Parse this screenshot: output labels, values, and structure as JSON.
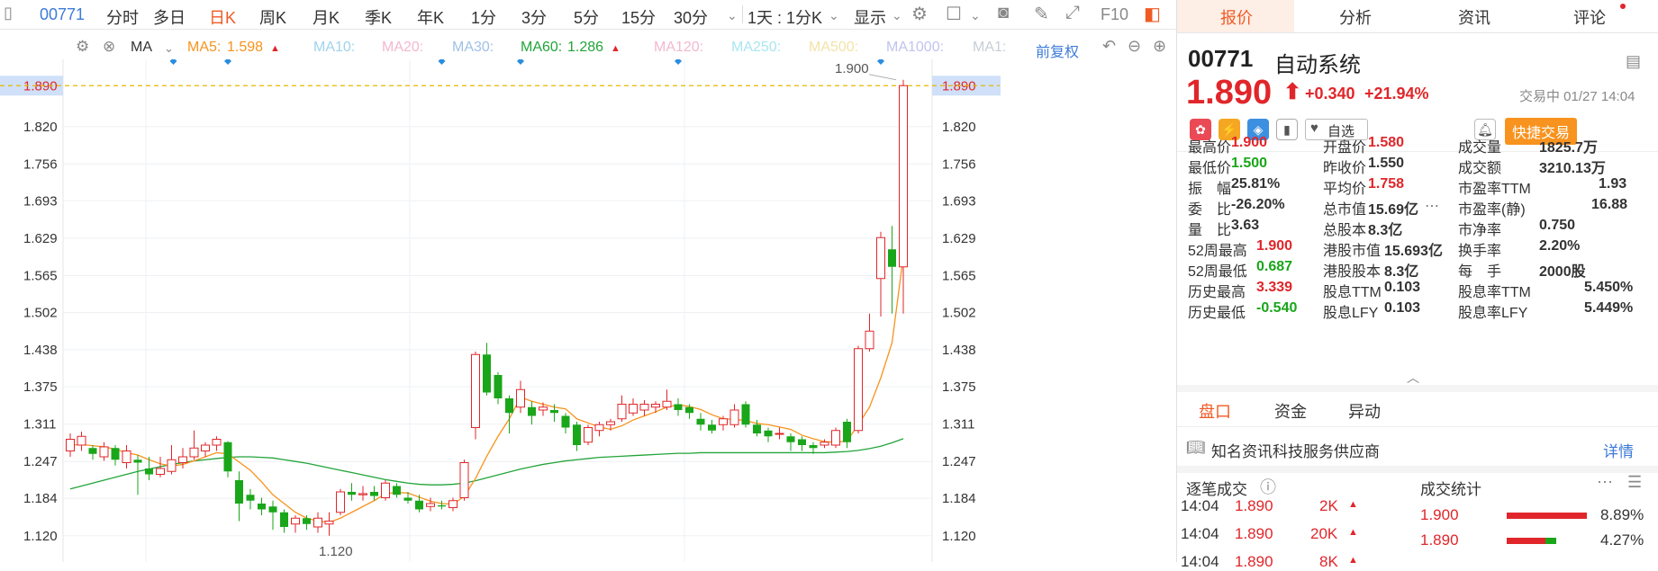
{
  "toolbar": {
    "code": "00771",
    "items": [
      "分时",
      "多日",
      "日K",
      "周K",
      "月K",
      "季K",
      "年K",
      "1分",
      "3分",
      "5分",
      "15分",
      "30分"
    ],
    "active": "日K",
    "combined": "1天 : 1分K",
    "display": "显示",
    "f10": "F10"
  },
  "ma_row": {
    "ma_label": "MA",
    "ma5_label": "MA5:",
    "ma5_value": "1.598",
    "ma10": "MA10:",
    "ma20": "MA20:",
    "ma30": "MA30:",
    "ma60_label": "MA60:",
    "ma60_value": "1.286",
    "ma120": "MA120:",
    "ma250": "MA250:",
    "ma500": "MA500:",
    "ma1000": "MA1000:",
    "ma1": "MA1:",
    "adjust": "前复权"
  },
  "chart_data": {
    "type": "candlestick",
    "price_ticks": [
      "1.890",
      "1.820",
      "1.756",
      "1.693",
      "1.629",
      "1.565",
      "1.502",
      "1.438",
      "1.375",
      "1.311",
      "1.247",
      "1.184",
      "1.120"
    ],
    "current_price_line": 1.89,
    "high_label": "1.900",
    "low_label": "1.120",
    "ylim": [
      1.075,
      1.935
    ],
    "candles": [
      {
        "o": 1.265,
        "c": 1.285,
        "h": 1.295,
        "l": 1.255
      },
      {
        "o": 1.275,
        "c": 1.29,
        "h": 1.298,
        "l": 1.265
      },
      {
        "o": 1.27,
        "c": 1.26,
        "h": 1.275,
        "l": 1.25
      },
      {
        "o": 1.255,
        "c": 1.272,
        "h": 1.28,
        "l": 1.248
      },
      {
        "o": 1.27,
        "c": 1.25,
        "h": 1.275,
        "l": 1.24
      },
      {
        "o": 1.245,
        "c": 1.265,
        "h": 1.275,
        "l": 1.235
      },
      {
        "o": 1.25,
        "c": 1.245,
        "h": 1.258,
        "l": 1.19
      },
      {
        "o": 1.235,
        "c": 1.225,
        "h": 1.255,
        "l": 1.215
      },
      {
        "o": 1.225,
        "c": 1.235,
        "h": 1.255,
        "l": 1.22
      },
      {
        "o": 1.23,
        "c": 1.25,
        "h": 1.275,
        "l": 1.225
      },
      {
        "o": 1.245,
        "c": 1.255,
        "h": 1.27,
        "l": 1.235
      },
      {
        "o": 1.255,
        "c": 1.27,
        "h": 1.3,
        "l": 1.25
      },
      {
        "o": 1.265,
        "c": 1.275,
        "h": 1.28,
        "l": 1.255
      },
      {
        "o": 1.275,
        "c": 1.285,
        "h": 1.29,
        "l": 1.265
      },
      {
        "o": 1.28,
        "c": 1.23,
        "h": 1.282,
        "l": 1.22
      },
      {
        "o": 1.215,
        "c": 1.175,
        "h": 1.23,
        "l": 1.145
      },
      {
        "o": 1.19,
        "c": 1.18,
        "h": 1.2,
        "l": 1.165
      },
      {
        "o": 1.175,
        "c": 1.165,
        "h": 1.185,
        "l": 1.155
      },
      {
        "o": 1.17,
        "c": 1.16,
        "h": 1.18,
        "l": 1.13
      },
      {
        "o": 1.16,
        "c": 1.135,
        "h": 1.165,
        "l": 1.125
      },
      {
        "o": 1.14,
        "c": 1.15,
        "h": 1.155,
        "l": 1.125
      },
      {
        "o": 1.15,
        "c": 1.14,
        "h": 1.155,
        "l": 1.13
      },
      {
        "o": 1.135,
        "c": 1.15,
        "h": 1.16,
        "l": 1.125
      },
      {
        "o": 1.14,
        "c": 1.145,
        "h": 1.16,
        "l": 1.12
      },
      {
        "o": 1.16,
        "c": 1.195,
        "h": 1.2,
        "l": 1.155
      },
      {
        "o": 1.195,
        "c": 1.19,
        "h": 1.21,
        "l": 1.18
      },
      {
        "o": 1.19,
        "c": 1.192,
        "h": 1.205,
        "l": 1.18
      },
      {
        "o": 1.195,
        "c": 1.188,
        "h": 1.205,
        "l": 1.18
      },
      {
        "o": 1.185,
        "c": 1.21,
        "h": 1.215,
        "l": 1.18
      },
      {
        "o": 1.205,
        "c": 1.19,
        "h": 1.21,
        "l": 1.185
      },
      {
        "o": 1.185,
        "c": 1.18,
        "h": 1.195,
        "l": 1.175
      },
      {
        "o": 1.18,
        "c": 1.165,
        "h": 1.19,
        "l": 1.16
      },
      {
        "o": 1.17,
        "c": 1.175,
        "h": 1.185,
        "l": 1.162
      },
      {
        "o": 1.172,
        "c": 1.17,
        "h": 1.18,
        "l": 1.165
      },
      {
        "o": 1.168,
        "c": 1.18,
        "h": 1.185,
        "l": 1.162
      },
      {
        "o": 1.185,
        "c": 1.245,
        "h": 1.25,
        "l": 1.18
      },
      {
        "o": 1.305,
        "c": 1.43,
        "h": 1.435,
        "l": 1.285
      },
      {
        "o": 1.43,
        "c": 1.365,
        "h": 1.45,
        "l": 1.36
      },
      {
        "o": 1.395,
        "c": 1.355,
        "h": 1.4,
        "l": 1.345
      },
      {
        "o": 1.355,
        "c": 1.33,
        "h": 1.36,
        "l": 1.295
      },
      {
        "o": 1.34,
        "c": 1.37,
        "h": 1.385,
        "l": 1.33
      },
      {
        "o": 1.34,
        "c": 1.325,
        "h": 1.35,
        "l": 1.31
      },
      {
        "o": 1.335,
        "c": 1.34,
        "h": 1.348,
        "l": 1.325
      },
      {
        "o": 1.335,
        "c": 1.33,
        "h": 1.345,
        "l": 1.315
      },
      {
        "o": 1.325,
        "c": 1.305,
        "h": 1.33,
        "l": 1.295
      },
      {
        "o": 1.31,
        "c": 1.275,
        "h": 1.315,
        "l": 1.265
      },
      {
        "o": 1.28,
        "c": 1.305,
        "h": 1.31,
        "l": 1.275
      },
      {
        "o": 1.3,
        "c": 1.31,
        "h": 1.315,
        "l": 1.29
      },
      {
        "o": 1.31,
        "c": 1.315,
        "h": 1.32,
        "l": 1.3
      },
      {
        "o": 1.32,
        "c": 1.345,
        "h": 1.36,
        "l": 1.315
      },
      {
        "o": 1.33,
        "c": 1.345,
        "h": 1.355,
        "l": 1.325
      },
      {
        "o": 1.335,
        "c": 1.345,
        "h": 1.352,
        "l": 1.325
      },
      {
        "o": 1.34,
        "c": 1.345,
        "h": 1.35,
        "l": 1.33
      },
      {
        "o": 1.34,
        "c": 1.35,
        "h": 1.37,
        "l": 1.335
      },
      {
        "o": 1.345,
        "c": 1.335,
        "h": 1.355,
        "l": 1.325
      },
      {
        "o": 1.34,
        "c": 1.33,
        "h": 1.345,
        "l": 1.32
      },
      {
        "o": 1.32,
        "c": 1.31,
        "h": 1.33,
        "l": 1.3
      },
      {
        "o": 1.31,
        "c": 1.3,
        "h": 1.318,
        "l": 1.295
      },
      {
        "o": 1.31,
        "c": 1.32,
        "h": 1.325,
        "l": 1.3
      },
      {
        "o": 1.31,
        "c": 1.335,
        "h": 1.345,
        "l": 1.305
      },
      {
        "o": 1.345,
        "c": 1.31,
        "h": 1.35,
        "l": 1.305
      },
      {
        "o": 1.31,
        "c": 1.295,
        "h": 1.318,
        "l": 1.29
      },
      {
        "o": 1.3,
        "c": 1.29,
        "h": 1.305,
        "l": 1.28
      },
      {
        "o": 1.295,
        "c": 1.295,
        "h": 1.305,
        "l": 1.285
      },
      {
        "o": 1.29,
        "c": 1.28,
        "h": 1.295,
        "l": 1.265
      },
      {
        "o": 1.285,
        "c": 1.275,
        "h": 1.29,
        "l": 1.265
      },
      {
        "o": 1.275,
        "c": 1.27,
        "h": 1.28,
        "l": 1.26
      },
      {
        "o": 1.275,
        "c": 1.28,
        "h": 1.285,
        "l": 1.27
      },
      {
        "o": 1.275,
        "c": 1.3,
        "h": 1.305,
        "l": 1.27
      },
      {
        "o": 1.315,
        "c": 1.28,
        "h": 1.32,
        "l": 1.27
      },
      {
        "o": 1.3,
        "c": 1.44,
        "h": 1.445,
        "l": 1.295
      },
      {
        "o": 1.44,
        "c": 1.47,
        "h": 1.5,
        "l": 1.435
      },
      {
        "o": 1.56,
        "c": 1.63,
        "h": 1.64,
        "l": 1.495
      },
      {
        "o": 1.61,
        "c": 1.58,
        "h": 1.65,
        "l": 1.5
      },
      {
        "o": 1.58,
        "c": 1.89,
        "h": 1.9,
        "l": 1.5
      }
    ],
    "ma5": [
      1.275,
      1.276,
      1.274,
      1.272,
      1.268,
      1.262,
      1.258,
      1.25,
      1.243,
      1.239,
      1.242,
      1.248,
      1.255,
      1.262,
      1.26,
      1.246,
      1.232,
      1.212,
      1.19,
      1.175,
      1.16,
      1.15,
      1.145,
      1.143,
      1.15,
      1.16,
      1.17,
      1.18,
      1.192,
      1.194,
      1.193,
      1.186,
      1.179,
      1.175,
      1.174,
      1.187,
      1.218,
      1.256,
      1.29,
      1.32,
      1.357,
      1.35,
      1.345,
      1.34,
      1.337,
      1.32,
      1.313,
      1.306,
      1.302,
      1.308,
      1.318,
      1.325,
      1.332,
      1.34,
      1.344,
      1.341,
      1.336,
      1.327,
      1.32,
      1.319,
      1.317,
      1.312,
      1.31,
      1.306,
      1.302,
      1.292,
      1.286,
      1.281,
      1.28,
      1.282,
      1.31,
      1.34,
      1.39,
      1.45,
      1.598
    ],
    "ma60": [
      1.2,
      1.205,
      1.21,
      1.215,
      1.22,
      1.225,
      1.23,
      1.234,
      1.238,
      1.242,
      1.245,
      1.248,
      1.25,
      1.252,
      1.254,
      1.255,
      1.255,
      1.254,
      1.253,
      1.25,
      1.247,
      1.244,
      1.24,
      1.236,
      1.232,
      1.228,
      1.224,
      1.22,
      1.216,
      1.213,
      1.21,
      1.208,
      1.207,
      1.207,
      1.208,
      1.21,
      1.214,
      1.219,
      1.224,
      1.229,
      1.234,
      1.238,
      1.242,
      1.245,
      1.248,
      1.25,
      1.252,
      1.254,
      1.255,
      1.256,
      1.257,
      1.258,
      1.259,
      1.26,
      1.261,
      1.261,
      1.262,
      1.262,
      1.262,
      1.262,
      1.262,
      1.262,
      1.262,
      1.262,
      1.262,
      1.262,
      1.262,
      1.262,
      1.263,
      1.264,
      1.266,
      1.269,
      1.273,
      1.279,
      1.286
    ],
    "markers": [
      9,
      14,
      33,
      40,
      54,
      72
    ]
  },
  "panel": {
    "tabs": [
      "报价",
      "分析",
      "资讯",
      "评论"
    ],
    "code": "00771",
    "name": "自动系统",
    "price": "1.890",
    "change": "+0.340",
    "change_pct": "+21.94%",
    "status": "交易中 01/27 14:04",
    "watch": "自选",
    "quick_trade": "快捷交易",
    "stats": [
      [
        {
          "l": "最高价",
          "v": "1.900",
          "c": "red"
        },
        {
          "l": "开盘价",
          "v": "1.580",
          "c": "red"
        },
        {
          "l": "成交量",
          "v": "1825.7万",
          "c": "dark"
        }
      ],
      [
        {
          "l": "最低价",
          "v": "1.500",
          "c": "green"
        },
        {
          "l": "昨收价",
          "v": "1.550",
          "c": "dark"
        },
        {
          "l": "成交额",
          "v": "3210.13万",
          "c": "dark"
        }
      ],
      [
        {
          "l": "振　幅",
          "v": "25.81%",
          "c": "dark"
        },
        {
          "l": "平均价",
          "v": "1.758",
          "c": "red"
        },
        {
          "l": "市盈率TTM",
          "v": "1.93",
          "c": "dark"
        }
      ],
      [
        {
          "l": "委　比",
          "v": "-26.20%",
          "c": "dark"
        },
        {
          "l": "总市值",
          "v": "15.69亿",
          "c": "dark"
        },
        {
          "l": "市盈率(静)",
          "v": "16.88",
          "c": "dark"
        }
      ],
      [
        {
          "l": "量　比",
          "v": "3.63",
          "c": "dark"
        },
        {
          "l": "总股本",
          "v": "8.3亿",
          "c": "dark"
        },
        {
          "l": "市净率",
          "v": "0.750",
          "c": "dark"
        }
      ],
      [
        {
          "l": "52周最高",
          "v": "1.900",
          "c": "red"
        },
        {
          "l": "港股市值",
          "v": "15.693亿",
          "c": "dark"
        },
        {
          "l": "换手率",
          "v": "2.20%",
          "c": "dark"
        }
      ],
      [
        {
          "l": "52周最低",
          "v": "0.687",
          "c": "green"
        },
        {
          "l": "港股股本",
          "v": "8.3亿",
          "c": "dark"
        },
        {
          "l": "每　手",
          "v": "2000股",
          "c": "dark"
        }
      ],
      [
        {
          "l": "历史最高",
          "v": "3.339",
          "c": "red"
        },
        {
          "l": "股息TTM",
          "v": "0.103",
          "c": "dark"
        },
        {
          "l": "股息率TTM",
          "v": "5.450%",
          "c": "dark"
        }
      ],
      [
        {
          "l": "历史最低",
          "v": "-0.540",
          "c": "green"
        },
        {
          "l": "股息LFY",
          "v": "0.103",
          "c": "dark"
        },
        {
          "l": "股息率LFY",
          "v": "5.449%",
          "c": "dark"
        }
      ]
    ],
    "subtabs": [
      "盘口",
      "资金",
      "异动"
    ],
    "provider": "知名资讯科技服务供应商",
    "detail": "详情",
    "trades_title": "逐笔成交",
    "stats_title": "成交统计",
    "trades": [
      {
        "time": "14:04",
        "price": "1.890",
        "vol": "2K"
      },
      {
        "time": "14:04",
        "price": "1.890",
        "vol": "20K"
      },
      {
        "time": "14:04",
        "price": "1.890",
        "vol": "8K"
      }
    ],
    "dist": [
      {
        "price": "1.900",
        "pct": "8.89%"
      },
      {
        "price": "1.890",
        "pct": "4.27%"
      }
    ]
  }
}
